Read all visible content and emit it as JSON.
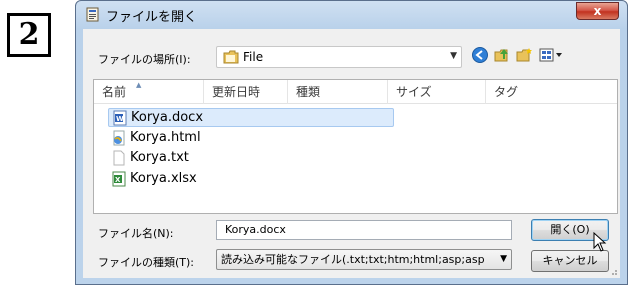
{
  "step_number": "2",
  "window": {
    "title": "ファイルを開く",
    "close_label": "x"
  },
  "lookin": {
    "label": "ファイルの場所(I):",
    "value": "File"
  },
  "columns": [
    "名前",
    "更新日時",
    "種類",
    "サイズ",
    "タグ"
  ],
  "files": [
    {
      "name": "Korya.docx",
      "icon": "word-doc-icon",
      "selected": true
    },
    {
      "name": "Korya.html",
      "icon": "html-file-icon",
      "selected": false
    },
    {
      "name": "Korya.txt",
      "icon": "text-file-icon",
      "selected": false
    },
    {
      "name": "Korya.xlsx",
      "icon": "excel-file-icon",
      "selected": false
    }
  ],
  "filename": {
    "label": "ファイル名(N):",
    "value": "Korya.docx"
  },
  "filetype": {
    "label": "ファイルの種類(T):",
    "value": "読み込み可能なファイル(.txt;txt;htm;html;asp;asp"
  },
  "buttons": {
    "open": "開く(O)",
    "cancel": "キャンセル"
  },
  "colors": {
    "title_gradient_top": "#cfe0f2",
    "selection": "#dcebfc",
    "close_button": "#c2321f"
  }
}
